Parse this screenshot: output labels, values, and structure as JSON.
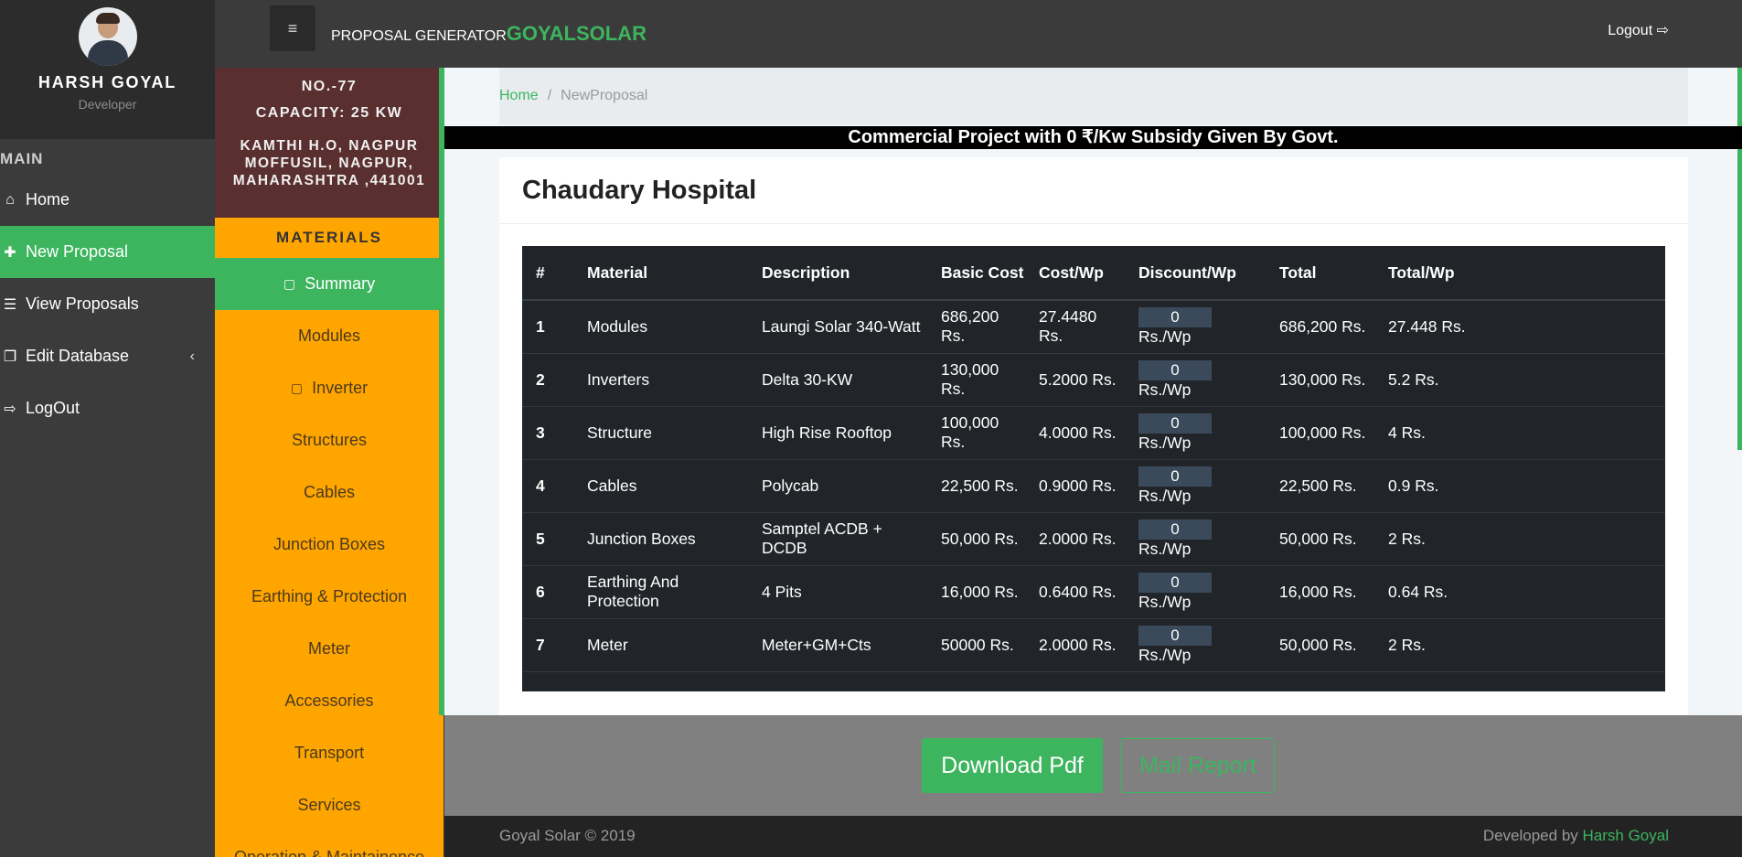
{
  "user": {
    "name": "HARSH GOYAL",
    "role": "Developer"
  },
  "sidebar": {
    "section": "MAIN",
    "items": [
      {
        "label": "Home",
        "icon": "home-icon"
      },
      {
        "label": "New Proposal",
        "icon": "plus-icon",
        "active": true
      },
      {
        "label": "View Proposals",
        "icon": "database-icon"
      },
      {
        "label": "Edit Database",
        "icon": "copy-icon"
      },
      {
        "label": "LogOut",
        "icon": "sign-out-icon"
      }
    ]
  },
  "topbar": {
    "brand_prefix": "PROPOSAL GENERATOR",
    "brand_name": "GOYALSOLAR",
    "logout_label": "Logout"
  },
  "project": {
    "no": "NO.-77",
    "capacity": "CAPACITY: 25 KW",
    "address": "KAMTHI H.O, NAGPUR MOFFUSIL, NAGPUR, MAHARASHTRA ,441001"
  },
  "materials": {
    "title": "MATERIALS",
    "items": [
      "Summary",
      "Modules",
      "Inverter",
      "Structures",
      "Cables",
      "Junction Boxes",
      "Earthing & Protection",
      "Meter",
      "Accessories",
      "Transport",
      "Services",
      "Operation & Maintainence"
    ]
  },
  "breadcrumb": {
    "home": "Home",
    "sep": "/",
    "current": "NewProposal"
  },
  "banner": "Commercial Project with 0 ₹/Kw Subsidy Given By Govt.",
  "card_title": "Chaudary Hospital",
  "table": {
    "headers": [
      "#",
      "Material",
      "Description",
      "Basic Cost",
      "Cost/Wp",
      "Discount/Wp",
      "Total",
      "Total/Wp"
    ],
    "unit": "Rs./Wp",
    "rows": [
      {
        "n": "1",
        "material": "Modules",
        "desc": "Laungi Solar 340-Watt",
        "basic": "686,200 Rs.",
        "costwp": "27.4480 Rs.",
        "disc": "0",
        "total": "686,200 Rs.",
        "totalwp": "27.448 Rs."
      },
      {
        "n": "2",
        "material": "Inverters",
        "desc": "Delta 30-KW",
        "basic": "130,000 Rs.",
        "costwp": "5.2000 Rs.",
        "disc": "0",
        "total": "130,000 Rs.",
        "totalwp": "5.2 Rs."
      },
      {
        "n": "3",
        "material": "Structure",
        "desc": "High Rise Rooftop",
        "basic": "100,000 Rs.",
        "costwp": "4.0000 Rs.",
        "disc": "0",
        "total": "100,000 Rs.",
        "totalwp": "4 Rs."
      },
      {
        "n": "4",
        "material": "Cables",
        "desc": "Polycab",
        "basic": "22,500 Rs.",
        "costwp": "0.9000 Rs.",
        "disc": "0",
        "total": "22,500 Rs.",
        "totalwp": "0.9 Rs."
      },
      {
        "n": "5",
        "material": "Junction Boxes",
        "desc": "Samptel ACDB + DCDB",
        "basic": "50,000 Rs.",
        "costwp": "2.0000 Rs.",
        "disc": "0",
        "total": "50,000 Rs.",
        "totalwp": "2 Rs."
      },
      {
        "n": "6",
        "material": "Earthing And Protection",
        "desc": "4 Pits",
        "basic": "16,000 Rs.",
        "costwp": "0.6400 Rs.",
        "disc": "0",
        "total": "16,000 Rs.",
        "totalwp": "0.64 Rs."
      },
      {
        "n": "7",
        "material": "Meter",
        "desc": "Meter+GM+Cts",
        "basic": "50000 Rs.",
        "costwp": "2.0000 Rs.",
        "disc": "0",
        "total": "50,000 Rs.",
        "totalwp": "2 Rs."
      }
    ]
  },
  "actions": {
    "pdf": "Download Pdf",
    "mail": "Mail Report"
  },
  "footer": {
    "copyright": "Goyal Solar © 2019",
    "dev_prefix": "Developed by",
    "dev_name": "Harsh Goyal"
  }
}
